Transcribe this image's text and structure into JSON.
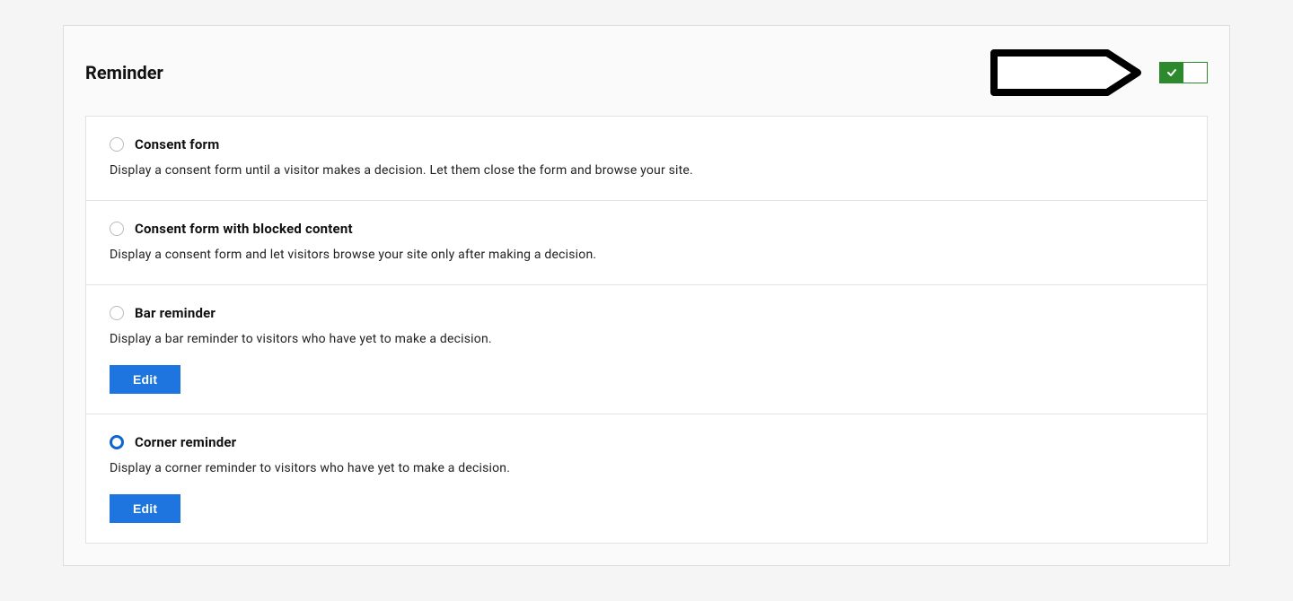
{
  "section": {
    "title": "Reminder",
    "toggle": {
      "enabled": true
    }
  },
  "options": [
    {
      "key": "consent-form",
      "title": "Consent form",
      "description": "Display a consent form until a visitor makes a decision. Let them close the form and browse your site.",
      "selected": false,
      "editable": false
    },
    {
      "key": "consent-form-blocked",
      "title": "Consent form with blocked content",
      "description": "Display a consent form and let visitors browse your site only after making a decision.",
      "selected": false,
      "editable": false
    },
    {
      "key": "bar-reminder",
      "title": "Bar reminder",
      "description": "Display a bar reminder to visitors who have yet to make a decision.",
      "selected": false,
      "editable": true,
      "edit_label": "Edit"
    },
    {
      "key": "corner-reminder",
      "title": "Corner reminder",
      "description": "Display a corner reminder to visitors who have yet to make a decision.",
      "selected": true,
      "editable": true,
      "edit_label": "Edit"
    }
  ]
}
